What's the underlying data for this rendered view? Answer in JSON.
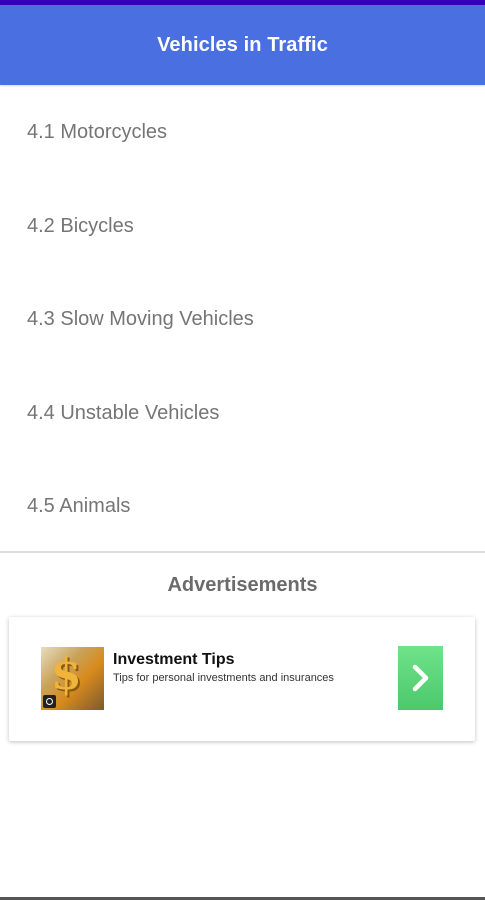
{
  "app_bar": {
    "title": "Vehicles in Traffic",
    "color": "#4a6fe0"
  },
  "list": {
    "items": [
      {
        "label": "4.1 Motorcycles"
      },
      {
        "label": "4.2 Bicycles"
      },
      {
        "label": "4.3 Slow Moving Vehicles"
      },
      {
        "label": "4.4 Unstable Vehicles"
      },
      {
        "label": "4.5 Animals"
      }
    ]
  },
  "ads": {
    "heading": "Advertisements",
    "card": {
      "image_icon": "dollar-sign-image",
      "title": "Investment Tips",
      "subtitle": "Tips for personal investments and insurances",
      "cta_icon": "chevron-right-icon",
      "cta_color": "#5ad178"
    }
  }
}
